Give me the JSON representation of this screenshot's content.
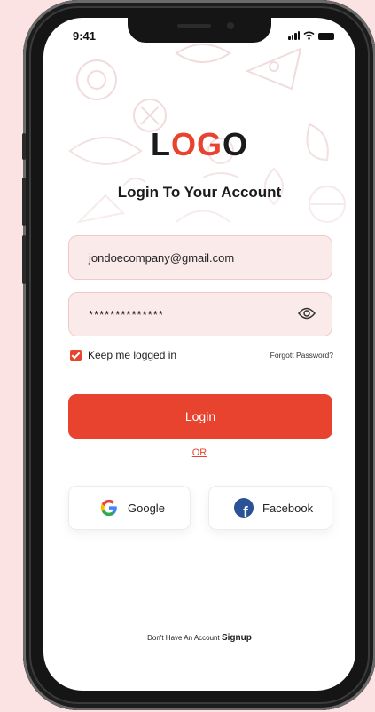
{
  "status_bar": {
    "time": "9:41"
  },
  "brand": {
    "logo_l": "L",
    "logo_o1": "O",
    "logo_g": "G",
    "logo_o2": "O"
  },
  "page": {
    "title": "Login To Your Account"
  },
  "form": {
    "email_value": "jondoecompany@gmail.com",
    "password_value": "**************",
    "remember_label": "Keep me logged in",
    "remember_checked": true,
    "forgot_label": "Forgott Password?",
    "login_label": "Login",
    "or_label": "OR"
  },
  "social": {
    "google_label": "Google",
    "facebook_label": "Facebook"
  },
  "footer": {
    "prompt": "Don't Have An Account",
    "signup_label": "Signup"
  },
  "colors": {
    "accent": "#e8432e",
    "field_bg": "#fbeaea",
    "page_bg": "#fbe3e3",
    "facebook": "#2a5297"
  },
  "icons": [
    "eye-icon",
    "checkbox-checked-icon",
    "google-icon",
    "facebook-icon",
    "signal-icon",
    "wifi-icon",
    "battery-icon"
  ]
}
